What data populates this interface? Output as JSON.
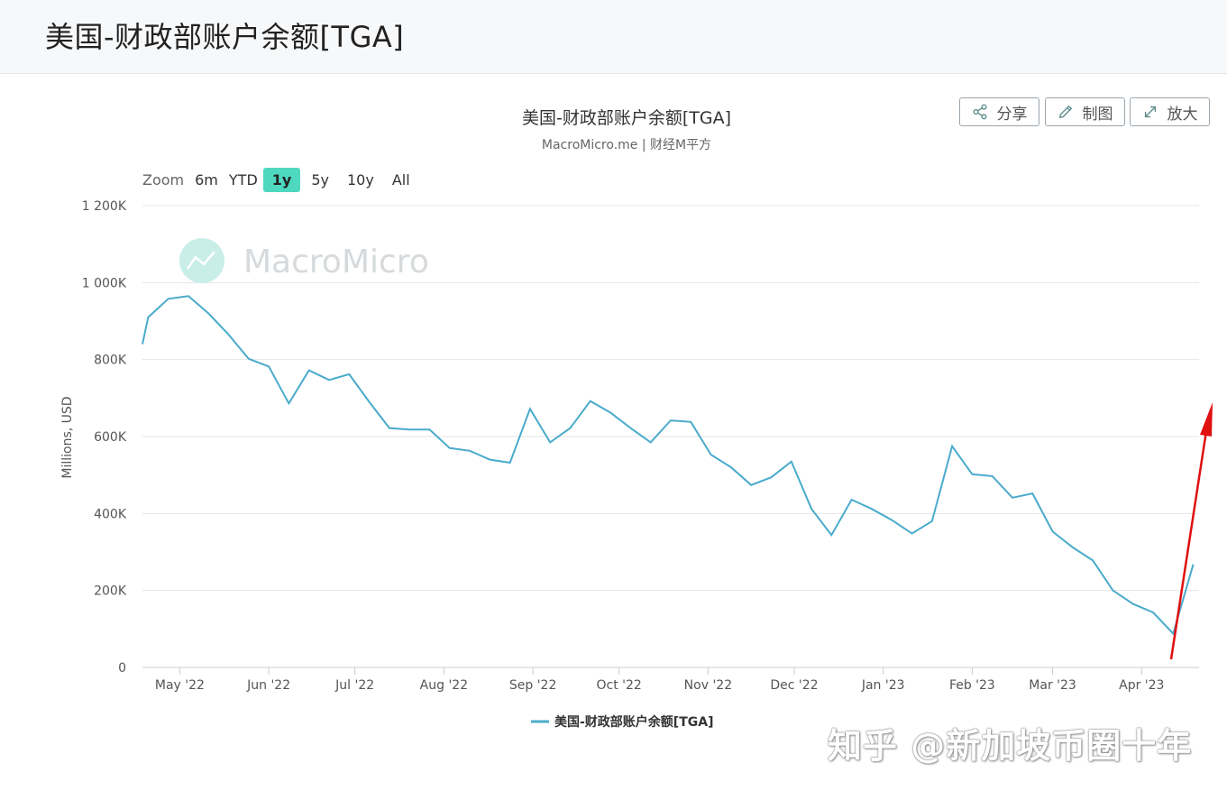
{
  "page": {
    "title": "美国-财政部账户余额[TGA]"
  },
  "toolbar": {
    "share_label": "分享",
    "draw_label": "制图",
    "zoom_label": "放大"
  },
  "zoom": {
    "label": "Zoom",
    "options": [
      "6m",
      "YTD",
      "1y",
      "5y",
      "10y",
      "All"
    ],
    "active": "1y"
  },
  "watermark": {
    "brand": "MacroMicro",
    "footer": "知乎 @新加坡币圈十年"
  },
  "colors": {
    "series": "#4aabcb",
    "active_zoom": "#4fd8c0",
    "arrow": "#e01010"
  },
  "chart_data": {
    "type": "line",
    "title": "美国-财政部账户余额[TGA]",
    "subtitle": "MacroMicro.me | 财经M平方",
    "ylabel": "Millions, USD",
    "xlabel": "",
    "ylim": [
      0,
      1200000
    ],
    "yticks": [
      0,
      200000,
      400000,
      600000,
      800000,
      1000000,
      1200000
    ],
    "ytick_labels": [
      "0",
      "200K",
      "400K",
      "600K",
      "800K",
      "1 000K",
      "1 200K"
    ],
    "xlim": [
      "2022-04-18",
      "2023-04-21"
    ],
    "xticks": [
      {
        "date": "2022-05-01",
        "label": "May '22"
      },
      {
        "date": "2022-06-01",
        "label": "Jun '22"
      },
      {
        "date": "2022-07-01",
        "label": "Jul '22"
      },
      {
        "date": "2022-08-01",
        "label": "Aug '22"
      },
      {
        "date": "2022-09-01",
        "label": "Sep '22"
      },
      {
        "date": "2022-10-01",
        "label": "Oct '22"
      },
      {
        "date": "2022-11-01",
        "label": "Nov '22"
      },
      {
        "date": "2022-12-01",
        "label": "Dec '22"
      },
      {
        "date": "2023-01-01",
        "label": "Jan '23"
      },
      {
        "date": "2023-02-01",
        "label": "Feb '23"
      },
      {
        "date": "2023-03-01",
        "label": "Mar '23"
      },
      {
        "date": "2023-04-01",
        "label": "Apr '23"
      }
    ],
    "grid": true,
    "legend": "bottom-center",
    "series": [
      {
        "name": "美国-财政部账户余额[TGA]",
        "x": [
          "2022-04-18",
          "2022-04-20",
          "2022-04-27",
          "2022-05-04",
          "2022-05-11",
          "2022-05-18",
          "2022-05-25",
          "2022-06-01",
          "2022-06-08",
          "2022-06-15",
          "2022-06-22",
          "2022-06-29",
          "2022-07-06",
          "2022-07-13",
          "2022-07-20",
          "2022-07-27",
          "2022-08-03",
          "2022-08-10",
          "2022-08-17",
          "2022-08-24",
          "2022-08-31",
          "2022-09-07",
          "2022-09-14",
          "2022-09-21",
          "2022-09-28",
          "2022-10-05",
          "2022-10-12",
          "2022-10-19",
          "2022-10-26",
          "2022-11-02",
          "2022-11-09",
          "2022-11-16",
          "2022-11-23",
          "2022-11-30",
          "2022-12-07",
          "2022-12-14",
          "2022-12-21",
          "2022-12-28",
          "2023-01-04",
          "2023-01-11",
          "2023-01-18",
          "2023-01-25",
          "2023-02-01",
          "2023-02-08",
          "2023-02-15",
          "2023-02-22",
          "2023-03-01",
          "2023-03-08",
          "2023-03-15",
          "2023-03-22",
          "2023-03-29",
          "2023-04-05",
          "2023-04-12",
          "2023-04-19"
        ],
        "values": [
          840000,
          910000,
          958000,
          965000,
          920000,
          865000,
          802000,
          782000,
          686000,
          772000,
          747000,
          762000,
          690000,
          622000,
          618000,
          618000,
          570000,
          563000,
          540000,
          532000,
          672000,
          585000,
          622000,
          692000,
          662000,
          622000,
          585000,
          642000,
          638000,
          553000,
          520000,
          474000,
          494000,
          535000,
          412000,
          344000,
          436000,
          412000,
          383000,
          348000,
          380000,
          575000,
          502000,
          497000,
          441000,
          452000,
          353000,
          312000,
          278000,
          200000,
          165000,
          143000,
          88000,
          268000
        ]
      }
    ]
  }
}
